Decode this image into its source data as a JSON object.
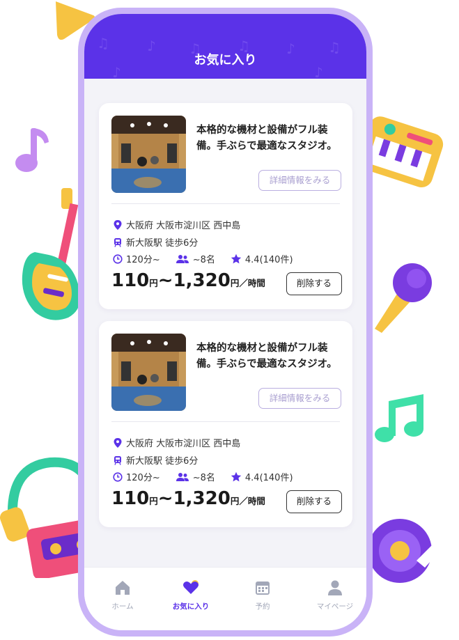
{
  "header": {
    "title": "お気に入り"
  },
  "cards": [
    {
      "description": "本格的な機材と設備がフル装備。手ぶらで最適なスタジオ。",
      "detail_label": "詳細情報をみる",
      "location": "大阪府 大阪市淀川区 西中島",
      "station": "新大阪駅 徒歩6分",
      "duration": "120分~",
      "capacity": "~8名",
      "rating": "4.4(140件)",
      "price_main": "110",
      "price_unit1": "円",
      "price_sep": "~",
      "price_max": "1,320",
      "price_unit2": "円／時間",
      "delete_label": "削除する"
    },
    {
      "description": "本格的な機材と設備がフル装備。手ぶらで最適なスタジオ。",
      "detail_label": "詳細情報をみる",
      "location": "大阪府 大阪市淀川区 西中島",
      "station": "新大阪駅 徒歩6分",
      "duration": "120分~",
      "capacity": "~8名",
      "rating": "4.4(140件)",
      "price_main": "110",
      "price_unit1": "円",
      "price_sep": "~",
      "price_max": "1,320",
      "price_unit2": "円／時間",
      "delete_label": "削除する"
    }
  ],
  "tabbar": {
    "items": [
      {
        "label": "ホーム",
        "icon": "home-icon"
      },
      {
        "label": "お気に入り",
        "icon": "heart-icon",
        "active": true
      },
      {
        "label": "予約",
        "icon": "calendar-icon"
      },
      {
        "label": "マイページ",
        "icon": "user-icon"
      }
    ]
  },
  "colors": {
    "primary": "#5b32e8",
    "frame": "#c9b3f7",
    "background": "#f3f3f8"
  }
}
